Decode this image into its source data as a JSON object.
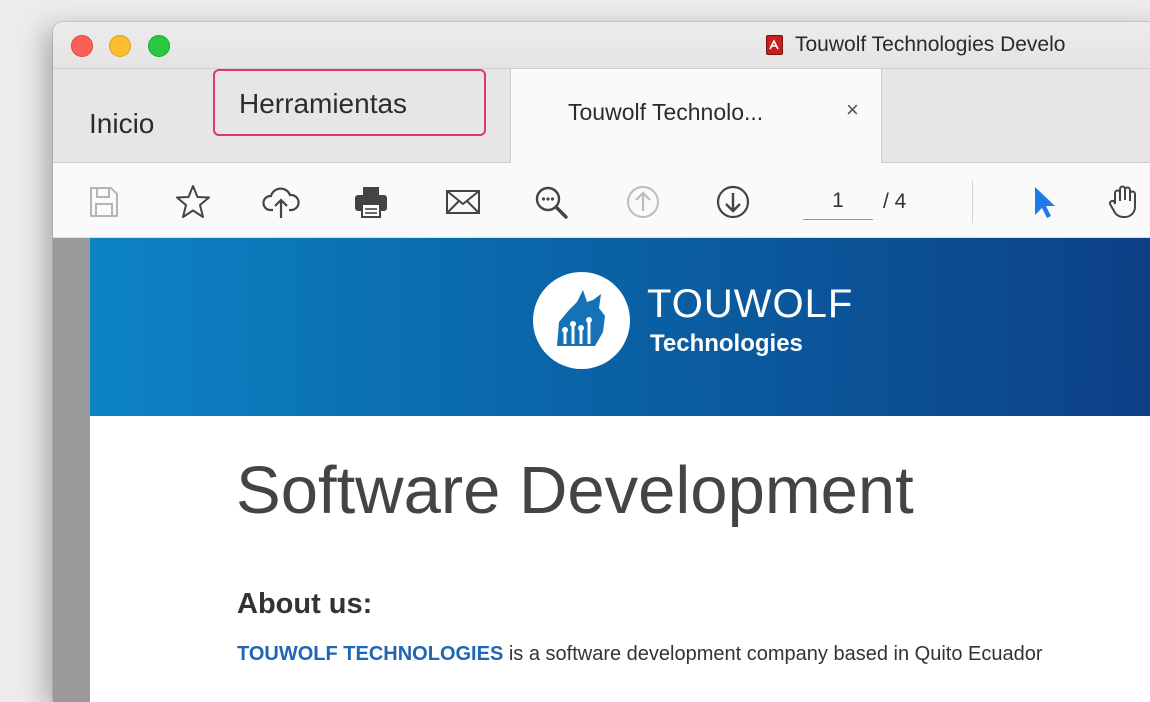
{
  "window": {
    "title": "Touwolf Technologies Develo",
    "traffic_lights": [
      "close",
      "minimize",
      "maximize"
    ]
  },
  "tabs": {
    "home": "Inicio",
    "tools": "Herramientas",
    "document": "Touwolf Technolo...",
    "close_symbol": "×",
    "highlight_color": "#e2347a"
  },
  "toolbar": {
    "icons": [
      "save-icon",
      "star-icon",
      "cloud-upload-icon",
      "print-icon",
      "mail-icon",
      "zoom-icon",
      "page-up-icon",
      "page-down-icon",
      "select-arrow-icon",
      "hand-icon"
    ],
    "page_current": "1",
    "page_total": "/ 4",
    "accent_color": "#1f7be8"
  },
  "document": {
    "logo_name": "TOUWOLF",
    "logo_sub": "Technologies",
    "title": "Software Development",
    "section_heading": "About us:",
    "para_company": "TOUWOLF TECHNOLOGIES",
    "para_rest": " is a software development company based in Quito Ecuador",
    "banner_colors": [
      "#0c83c4",
      "#0d3f85"
    ]
  }
}
